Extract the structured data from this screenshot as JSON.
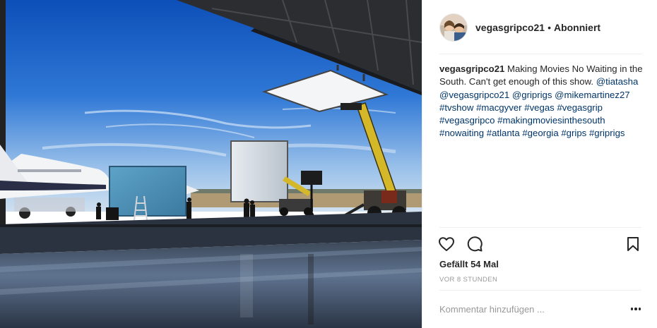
{
  "post": {
    "image_alt": "Film set in an airplane hangar",
    "username": "vegasgripco21",
    "separator": "•",
    "follow_status": "Abonniert",
    "caption": {
      "username": "vegasgripco21",
      "text": " Making Movies No Waiting in the South. Can't get enough of this show. ",
      "mentions_and_tags": [
        "@tiatasha",
        "@vegasgripco21",
        "@griprigs",
        "@mikemartinez27",
        "#tvshow",
        "#macgyver",
        "#vegas",
        "#vegasgrip",
        "#vegasgripco",
        "#makingmoviesinthesouth",
        "#nowaiting",
        "#atlanta",
        "#georgia",
        "#grips",
        "#griprigs"
      ]
    },
    "actions": {
      "like_icon": "heart-outline-icon",
      "comment_icon": "speech-bubble-icon",
      "save_icon": "bookmark-icon"
    },
    "likes": "Gefällt 54 Mal",
    "timestamp": "VOR 8 STUNDEN",
    "comment_placeholder": "Kommentar hinzufügen ...",
    "more_icon": "more-options-icon"
  },
  "colors": {
    "text": "#262626",
    "link": "#003569",
    "muted": "#999999",
    "divider": "#efefef",
    "sky": "#1d5fc4"
  }
}
